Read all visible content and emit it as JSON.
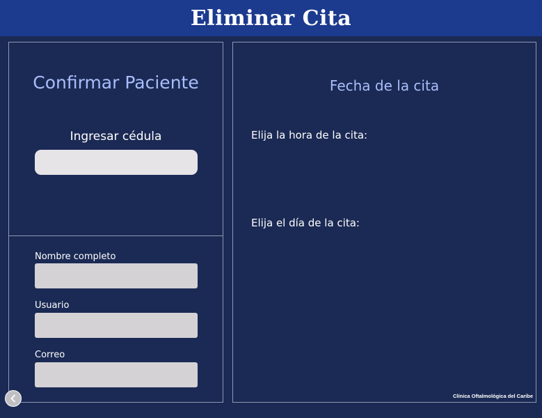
{
  "header": {
    "title": "Eliminar Cita"
  },
  "patient_panel": {
    "title": "Confirmar Paciente",
    "id_label": "Ingresar cédula",
    "id_value": ""
  },
  "details_panel": {
    "fields": [
      {
        "label": "Nombre completo",
        "value": ""
      },
      {
        "label": "Usuario",
        "value": ""
      },
      {
        "label": "Correo",
        "value": ""
      }
    ]
  },
  "date_panel": {
    "title": "Fecha de la cita",
    "hour_label": "Elija la hora de la cita:",
    "day_label": "Elija el día de la cita:",
    "brand": "Clínica Oftalmológica del Caribe"
  },
  "navigation": {
    "back_icon": "chevron-left-icon"
  },
  "colors": {
    "background": "#1b2a54",
    "header": "#1c3a8e",
    "accent_text": "#a9bdfb",
    "input_fill": "#d4d2d5"
  }
}
